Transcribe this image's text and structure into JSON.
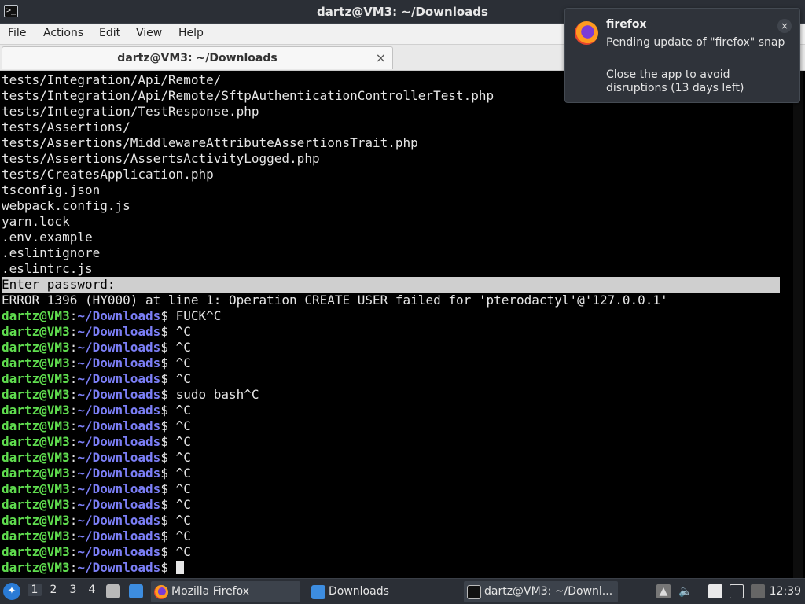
{
  "window": {
    "title": "dartz@VM3: ~/Downloads",
    "icon": "terminal-icon"
  },
  "menubar": {
    "items": [
      "File",
      "Actions",
      "Edit",
      "View",
      "Help"
    ]
  },
  "tab": {
    "label": "dartz@VM3: ~/Downloads",
    "close_glyph": "×"
  },
  "terminal": {
    "prompt_user": "dartz@VM3",
    "prompt_sep": ":",
    "prompt_path": "~/Downloads",
    "prompt_symbol": "$ ",
    "output_lines": [
      "tests/Integration/Api/Remote/",
      "tests/Integration/Api/Remote/SftpAuthenticationControllerTest.php",
      "tests/Integration/TestResponse.php",
      "tests/Assertions/",
      "tests/Assertions/MiddlewareAttributeAssertionsTrait.php",
      "tests/Assertions/AssertsActivityLogged.php",
      "tests/CreatesApplication.php",
      "tsconfig.json",
      "webpack.config.js",
      "yarn.lock",
      ".env.example",
      ".eslintignore",
      ".eslintrc.js"
    ],
    "password_prompt": "Enter password: ",
    "error_line": "ERROR 1396 (HY000) at line 1: Operation CREATE USER failed for 'pterodactyl'@'127.0.0.1'",
    "commands": [
      "FUCK^C",
      "^C",
      "^C",
      "^C",
      "^C",
      "sudo bash^C",
      "^C",
      "^C",
      "^C",
      "^C",
      "^C",
      "^C",
      "^C",
      "^C",
      "^C",
      "^C",
      ""
    ]
  },
  "notification": {
    "app": "firefox",
    "body1": "Pending update of \"firefox\" snap",
    "body2": "Close the app to avoid disruptions (13 days left)",
    "close_glyph": "×"
  },
  "taskbar": {
    "workspaces": [
      "1",
      "2",
      "3",
      "4"
    ],
    "active_workspace": "1",
    "tasks": [
      {
        "label": "Mozilla Firefox",
        "icon": "firefox-icon"
      },
      {
        "label": "Downloads",
        "icon": "folder-icon"
      },
      {
        "label": "dartz@VM3: ~/Downl...",
        "icon": "terminal-icon"
      }
    ],
    "clock": "12:39"
  }
}
